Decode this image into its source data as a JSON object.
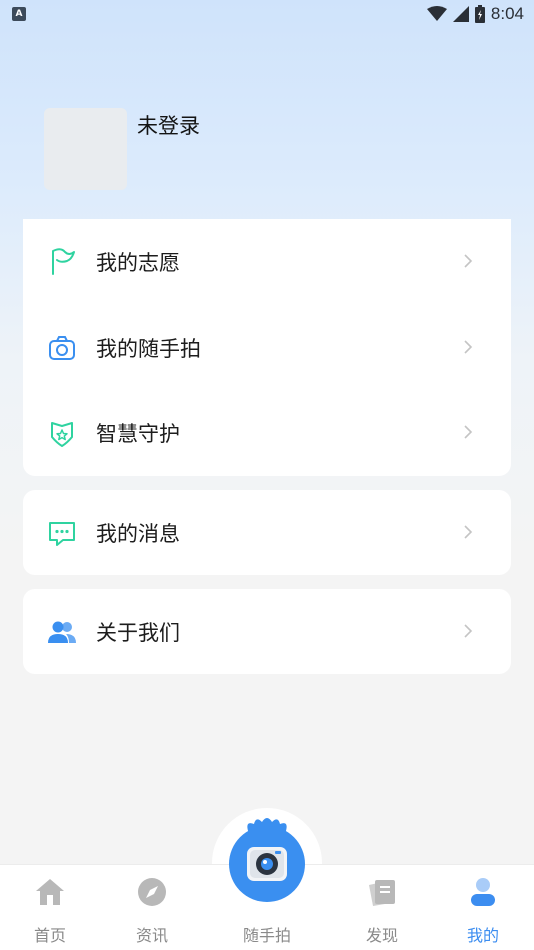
{
  "status_bar": {
    "time": "8:04",
    "left_icon": "A",
    "icons": [
      "wifi-icon",
      "signal-icon",
      "battery-icon"
    ]
  },
  "profile": {
    "name": "未登录"
  },
  "menu_group_1": [
    {
      "label": "我的志愿",
      "icon": "flag-icon"
    },
    {
      "label": "我的随手拍",
      "icon": "camera-icon"
    },
    {
      "label": "智慧守护",
      "icon": "shield-star-icon"
    }
  ],
  "menu_group_2": [
    {
      "label": "我的消息",
      "icon": "message-icon"
    }
  ],
  "menu_group_3": [
    {
      "label": "关于我们",
      "icon": "group-icon"
    }
  ],
  "bottom_nav": [
    {
      "label": "首页",
      "icon": "home-icon",
      "active": false
    },
    {
      "label": "资讯",
      "icon": "compass-icon",
      "active": false
    },
    {
      "label": "随手拍",
      "icon": "camera-button-icon",
      "active": false
    },
    {
      "label": "发现",
      "icon": "discover-icon",
      "active": false
    },
    {
      "label": "我的",
      "icon": "user-icon",
      "active": true
    }
  ],
  "colors": {
    "accent": "#3c8df0",
    "green": "#2fd3a0",
    "blue": "#3a8ff0"
  }
}
